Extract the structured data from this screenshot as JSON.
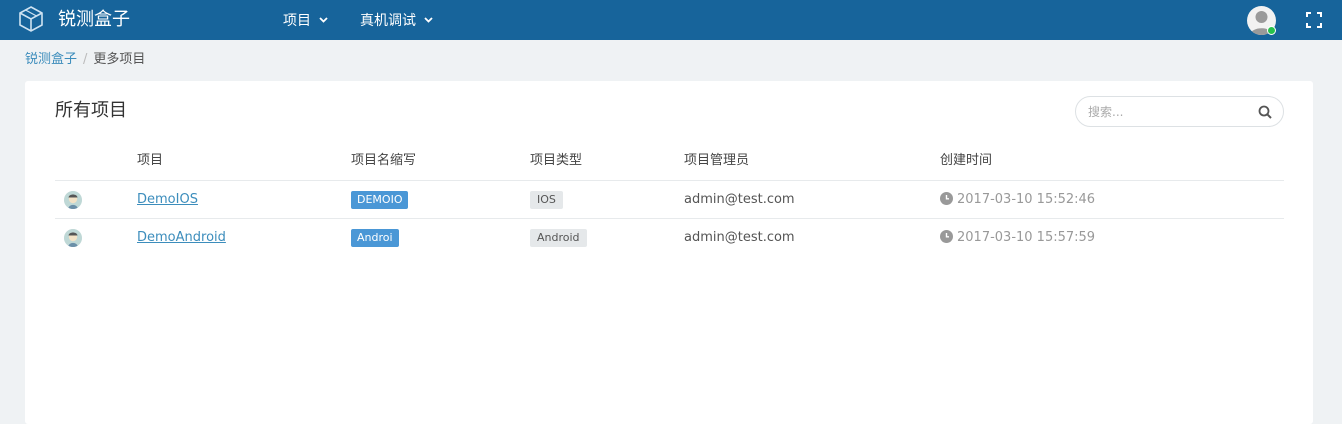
{
  "header": {
    "brand": "锐测盒子",
    "nav": [
      {
        "label": "项目",
        "icon": "chevron-down-icon"
      },
      {
        "label": "真机调试",
        "icon": "chevron-down-icon"
      }
    ],
    "user_status": "online",
    "colors": {
      "bar": "#17649b",
      "status": "#27c24c"
    }
  },
  "breadcrumb": {
    "home": "锐测盒子",
    "separator": "/",
    "current": "更多项目"
  },
  "main": {
    "title": "所有项目",
    "search": {
      "placeholder": "搜索..."
    },
    "table": {
      "columns": [
        "项目",
        "项目名缩写",
        "项目类型",
        "项目管理员",
        "创建时间"
      ],
      "rows": [
        {
          "name": "DemoIOS",
          "abbr": "DEMOIO",
          "type": "IOS",
          "manager": "admin@test.com",
          "created": "2017-03-10 15:52:46"
        },
        {
          "name": "DemoAndroid",
          "abbr": "Androi",
          "type": "Android",
          "manager": "admin@test.com",
          "created": "2017-03-10 15:57:59"
        }
      ]
    },
    "colors": {
      "link": "#3c8dbc",
      "abbr_badge": "#4a97d6",
      "type_badge": "#e5e8ea"
    }
  }
}
